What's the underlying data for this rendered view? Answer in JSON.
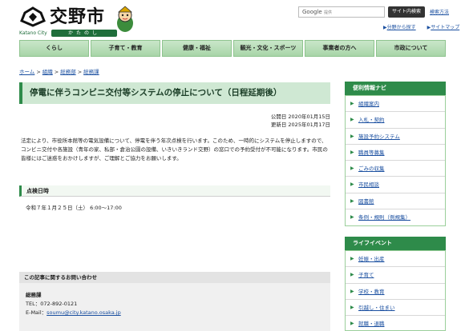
{
  "header": {
    "city_name": "交野市",
    "city_en": "Katano City",
    "city_kana": "かたのし",
    "search_brand": "Google",
    "search_placeholder": "提供",
    "search_button": "サイト内検索",
    "search_help": "検索方法",
    "links": [
      "分野から探す",
      "サイトマップ"
    ]
  },
  "gnav": [
    "くらし",
    "子育て・教育",
    "健康・福祉",
    "観光・文化・スポーツ",
    "事業者の方へ",
    "市政について"
  ],
  "breadcrumb": [
    "ホーム",
    "組織",
    "総務部",
    "総務課"
  ],
  "article": {
    "title": "停電に伴うコンビニ交付等システムの停止について（日程延期後）",
    "published": "公開日 2020年01月15日",
    "updated": "更新日 2025年01月17日",
    "body": "法定により、市役所本館等の電気設備について、停電を伴う年次点検を行います。このため、一時的にシステムを停止しますので、コンビニ交付や各施設（青年の家、私部・倉治公園の設備、いきいきランド交野）の窓口での予約受付が不可能になります。市民の皆様にはご迷惑をおかけしますが、ご理解とご協力をお願いします。",
    "section_heading": "点検日時",
    "section_text": "令和７年１月２５日（土） 6:00〜17:00"
  },
  "contact": {
    "heading": "この記事に関するお問い合わせ",
    "dept": "総務課",
    "tel": "TEL：072-892-0121",
    "email_label": "E-Mail：",
    "email": "soumu@city.katano.osaka.jp"
  },
  "sidebar": {
    "nav_title": "便利情報ナビ",
    "nav_items": [
      "組織案内",
      "入札・契約",
      "施設予約システム",
      "職員等募集",
      "ごみの収集",
      "市民相談",
      "図書館",
      "条例・規則（例規集）"
    ],
    "life_title": "ライフイベント",
    "life_items": [
      "妊娠・出産",
      "子育て",
      "学校・教育",
      "引越し・住まい",
      "就職・退職"
    ]
  },
  "colors": {
    "accent": "#2e8b4a",
    "title_bg": "#cfe8d3",
    "nav_bg": "#a8d5a8",
    "link": "#1a4fa0"
  }
}
